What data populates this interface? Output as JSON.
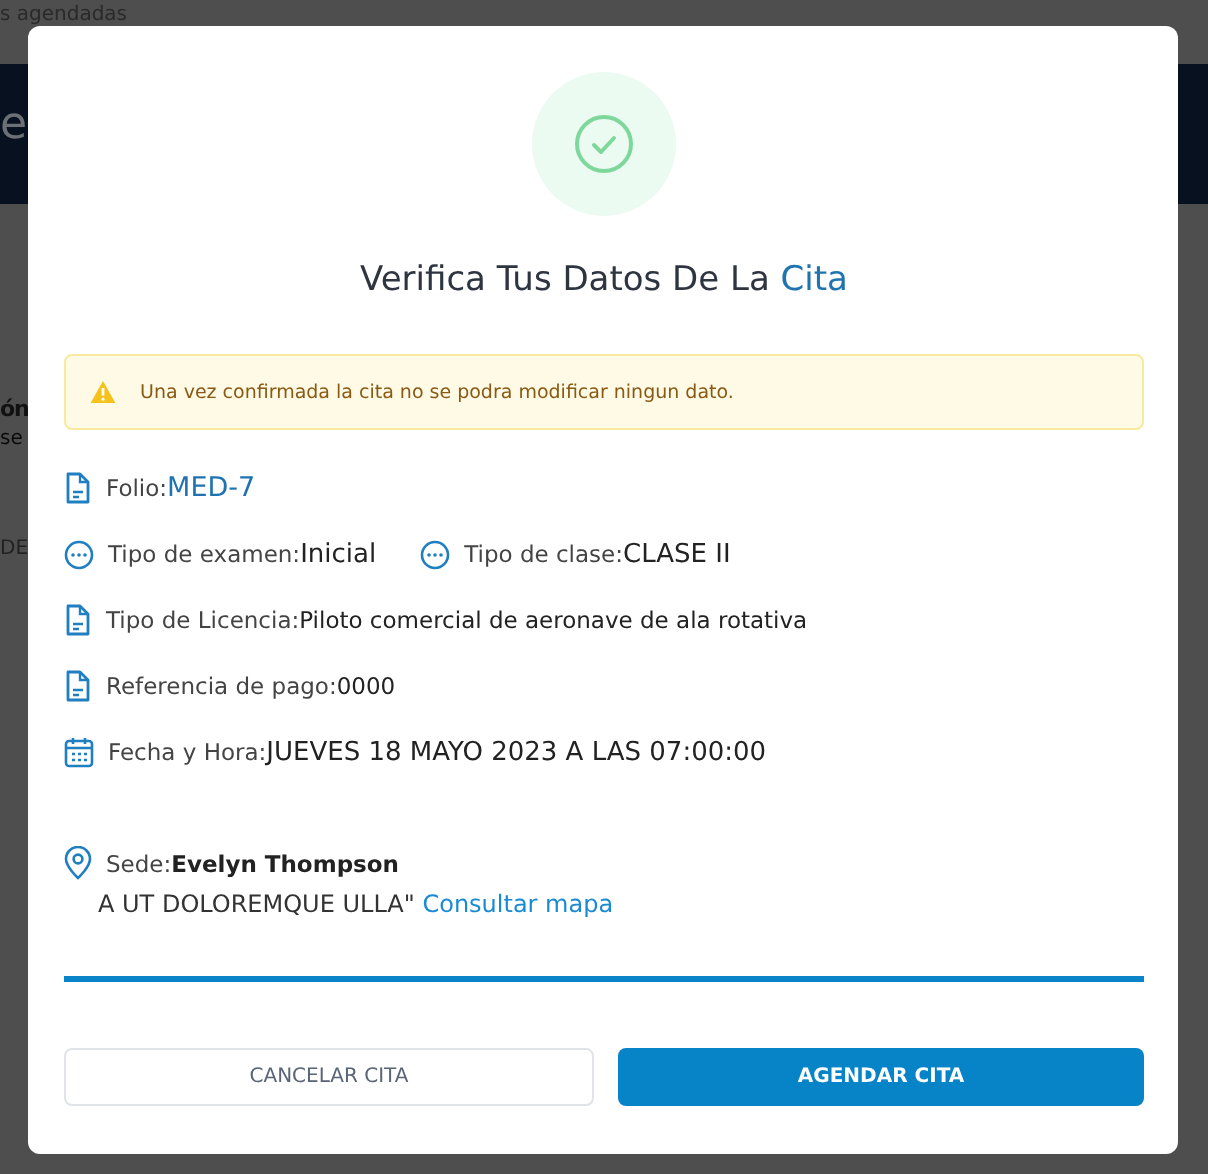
{
  "background": {
    "breadcrumb": "s agendadas",
    "header_text": "e",
    "section_title": "ón",
    "section_text": "se",
    "table_text": "DE"
  },
  "dialog": {
    "title": "Verifica Tus Datos De La ",
    "title_highlight": "Cita",
    "alert": {
      "kind": "warning",
      "text": "Una vez confirmada la cita no se podra modificar ningun dato."
    },
    "rows": [
      [
        {
          "kind": "document",
          "label": "Folio:",
          "value": "MED-7",
          "accent": true
        }
      ],
      [
        {
          "kind": "dots",
          "label": "Tipo de examen:",
          "value": "Inicial",
          "accent": false
        },
        {
          "kind": "dots",
          "label": "Tipo de clase:",
          "value": "CLASE II",
          "accent": false
        }
      ],
      [
        {
          "kind": "document",
          "label": "Tipo de Licencia:",
          "value": "Piloto comercial de aeronave de ala rotativa",
          "accent": false
        }
      ],
      [
        {
          "kind": "document",
          "label": "Referencia de pago:",
          "value": "0000",
          "accent": false
        }
      ],
      [
        {
          "kind": "calendar",
          "label": "Fecha y Hora:",
          "value": "JUEVES 18 MAYO 2023 A LAS 07:00:00",
          "accent": false
        }
      ]
    ],
    "location": {
      "label": "Sede:",
      "value": "Evelyn Thompson",
      "address": "A UT DOLOREMQUE ULLA\"",
      "map_link": "Consultar mapa"
    },
    "buttons": [
      {
        "kind": "secondary",
        "label": "CANCELAR CITA"
      },
      {
        "kind": "primary",
        "label": "AGENDAR CITA"
      }
    ]
  }
}
